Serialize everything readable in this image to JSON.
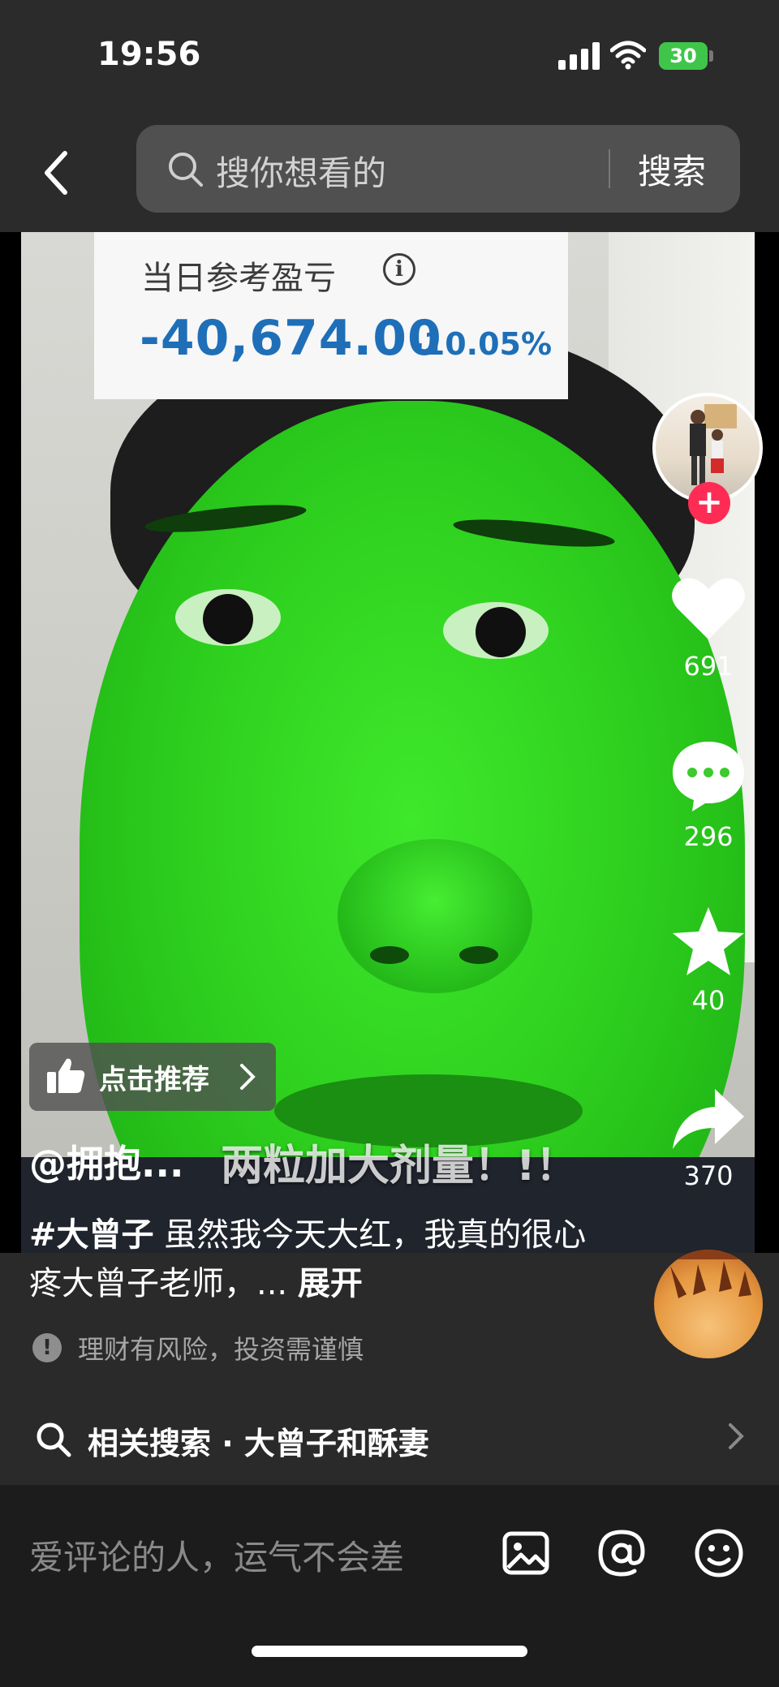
{
  "status_bar": {
    "time": "19:56",
    "battery": "30"
  },
  "top_nav": {
    "search_placeholder": "搜你想看的",
    "search_button": "搜索"
  },
  "video": {
    "overlay_card": {
      "label": "当日参考盈亏",
      "value": "-40,674.00",
      "percent": "-10.05%"
    },
    "subtitle": "两粒加大剂量！!！"
  },
  "sidebar": {
    "likes": "691",
    "comments": "296",
    "favorites": "40",
    "shares": "370"
  },
  "recommend_chip": "点击推荐",
  "author": "@拥抱...",
  "description": {
    "hashtag": "#大曾子",
    "text": " 虽然我今天大红，我真的很心疼大曾子老师，...",
    "expand": "展开"
  },
  "risk_notice": "理财有风险，投资需谨慎",
  "related_search": "相关搜索 · 大曾子和酥妻",
  "comment_bar": {
    "placeholder": "爱评论的人，运气不会差"
  },
  "colors": {
    "accent": "#fe2c55",
    "pnl_blue": "#1e6fb8",
    "battery_green": "#3fc64a"
  }
}
